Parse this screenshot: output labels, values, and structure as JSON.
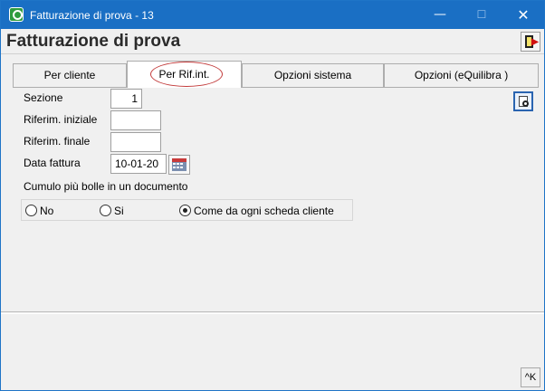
{
  "window": {
    "title": "Fatturazione di prova - 13",
    "controls": {
      "minimize": "—",
      "maximize": "☐",
      "close": "✕"
    }
  },
  "header": {
    "title": "Fatturazione di prova"
  },
  "tabs": [
    {
      "label": "Per cliente",
      "active": false
    },
    {
      "label": "Per Rif.int.",
      "active": true
    },
    {
      "label": "Opzioni sistema",
      "active": false
    },
    {
      "label": "Opzioni (eQuilibra )",
      "active": false
    }
  ],
  "form": {
    "sezione": {
      "label": "Sezione",
      "value": "1"
    },
    "rif_iniziale": {
      "label": "Riferim. iniziale",
      "value": ""
    },
    "rif_finale": {
      "label": "Riferim. finale",
      "value": ""
    },
    "data_fattura": {
      "label": "Data fattura",
      "value": "10-01-20"
    }
  },
  "cumulo": {
    "label": "Cumulo più bolle in un documento",
    "options": [
      {
        "label": "No",
        "checked": false
      },
      {
        "label": "Si",
        "checked": false
      },
      {
        "label": "Come da ogni scheda cliente",
        "checked": true
      }
    ]
  },
  "footer": {
    "key_button": "^K"
  },
  "icons": {
    "app": "qlik-app-icon",
    "exit": "exit-door-icon",
    "print_preview": "print-preview-icon",
    "calendar": "calendar-icon"
  },
  "colors": {
    "titlebar": "#1a6fc4",
    "highlight_ring": "#c23a3a"
  }
}
